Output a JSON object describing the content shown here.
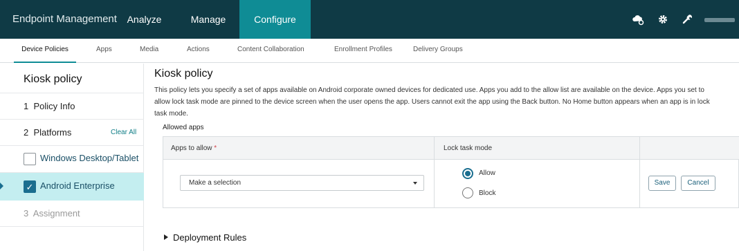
{
  "topbar": {
    "brand": "Endpoint Management",
    "nav": [
      {
        "label": "Analyze"
      },
      {
        "label": "Manage"
      },
      {
        "label": "Configure",
        "active": true
      }
    ],
    "icons": [
      "cloud-gear-icon",
      "gear-icon",
      "wrench-icon"
    ],
    "colors": {
      "bar": "#0f3a45",
      "active": "#0f8c95"
    }
  },
  "subtabs": [
    {
      "label": "Device Policies",
      "active": true
    },
    {
      "label": "Apps"
    },
    {
      "label": "Media"
    },
    {
      "label": "Actions"
    },
    {
      "label": "Content Collaboration"
    },
    {
      "label": "Enrollment Profiles"
    },
    {
      "label": "Delivery Groups"
    }
  ],
  "sidebar": {
    "title": "Kiosk policy",
    "steps": {
      "policy_info": "1  Policy Info",
      "platforms": "2  Platforms",
      "clear_all": "Clear All",
      "assignment": "3  Assignment"
    },
    "platforms": [
      {
        "label": "Windows Desktop/Tablet",
        "checked": false
      },
      {
        "label": "Android Enterprise",
        "checked": true,
        "active": true
      }
    ]
  },
  "main": {
    "title": "Kiosk policy",
    "description": "This policy lets you specify a set of apps available on Android corporate owned devices for dedicated use. Apps you add to the allow list are available on the device. Apps you set to allow lock task mode are pinned to the device screen when the user opens the app. Users cannot exit the app using the Back button. No Home button appears when an app is in lock task mode.",
    "section_label": "Allowed apps",
    "table": {
      "col_apps": "Apps to allow",
      "required_mark": "*",
      "col_lock": "Lock task mode",
      "select_value": "Make a selection",
      "radio_allow": "Allow",
      "radio_block": "Block",
      "selected_mode": "Allow",
      "save": "Save",
      "cancel": "Cancel"
    },
    "deployment_rules": "Deployment Rules"
  }
}
